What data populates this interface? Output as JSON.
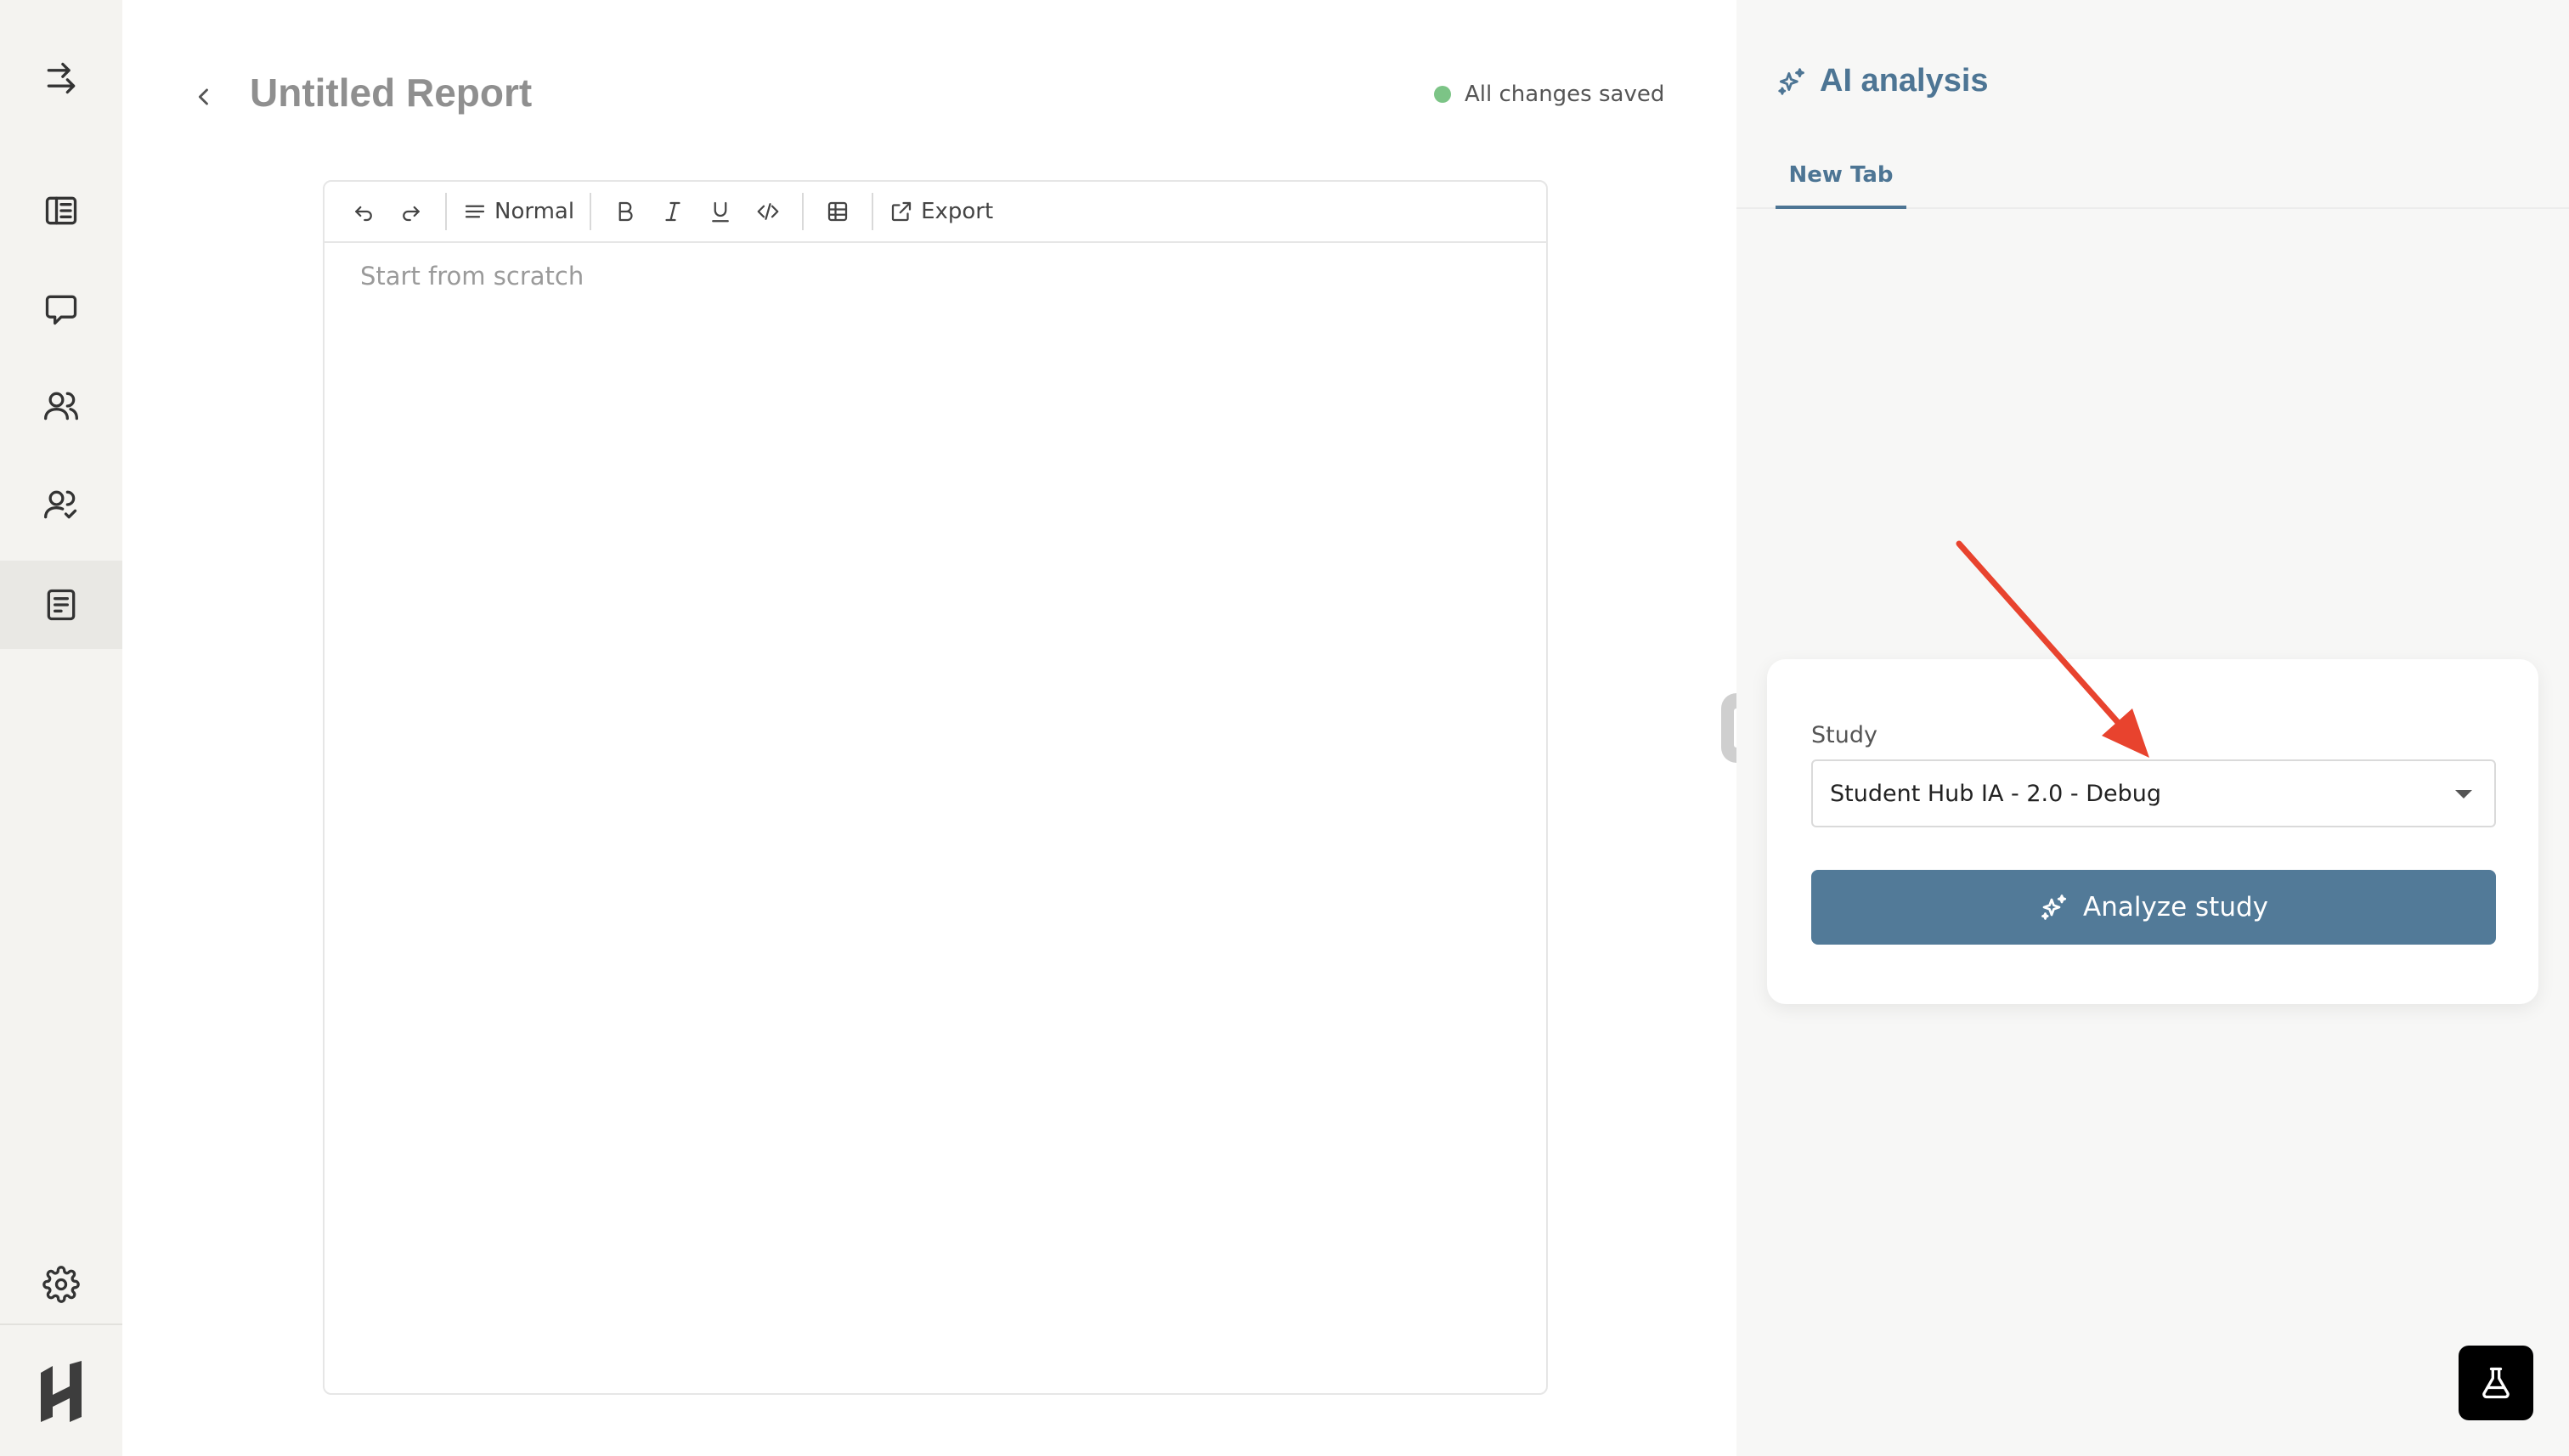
{
  "nav": {
    "items": [
      {
        "name": "collapse",
        "icon": "arrow-right-expand-icon"
      },
      {
        "name": "library",
        "icon": "book-icon"
      },
      {
        "name": "chat",
        "icon": "chat-bubble-icon"
      },
      {
        "name": "participants",
        "icon": "users-icon"
      },
      {
        "name": "users-verified",
        "icon": "user-check-icon"
      },
      {
        "name": "reports",
        "icon": "document-icon",
        "active": true
      }
    ],
    "settings_icon": "gear-icon",
    "logo_icon": "h-logo-icon"
  },
  "report": {
    "title": "Untitled Report",
    "save_status": "All changes saved",
    "save_status_color": "#7cc486"
  },
  "toolbar": {
    "undo_icon": "undo-icon",
    "redo_icon": "redo-icon",
    "text_style": "Normal",
    "bold_icon": "bold-icon",
    "italic_icon": "italic-icon",
    "underline_icon": "underline-icon",
    "code_icon": "code-icon",
    "table_icon": "table-icon",
    "export_label": "Export"
  },
  "editor": {
    "placeholder": "Start from scratch"
  },
  "ai_panel": {
    "title": "AI analysis",
    "tabs": [
      {
        "label": "New Tab",
        "active": true
      }
    ],
    "study_label": "Study",
    "study_selected": "Student Hub IA - 2.0 - Debug",
    "analyze_label": "Analyze study",
    "accent_color": "#527a98"
  },
  "annotation": {
    "arrow_color": "#e8432e"
  }
}
